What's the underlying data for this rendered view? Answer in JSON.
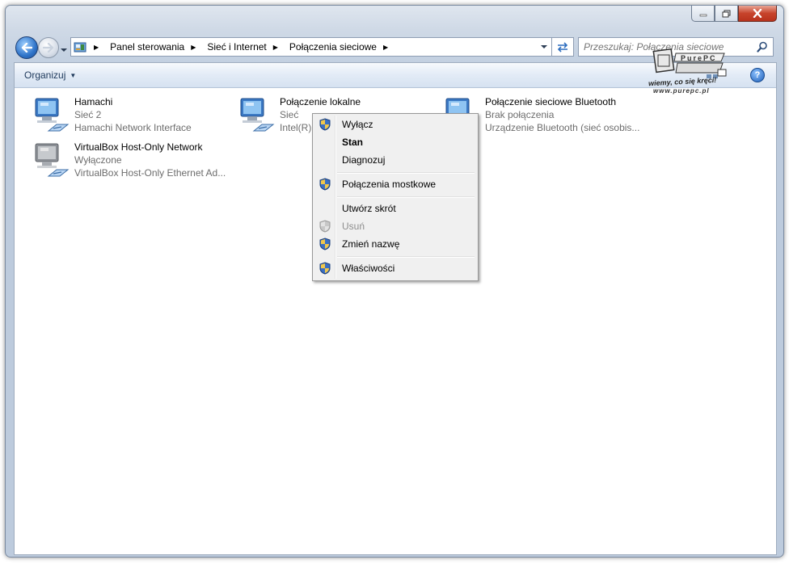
{
  "window": {
    "caption_buttons": [
      "minimize",
      "maximize",
      "close"
    ]
  },
  "address_bar": {
    "breadcrumbs": [
      "Panel sterowania",
      "Sieć i Internet",
      "Połączenia sieciowe"
    ]
  },
  "search": {
    "placeholder": "Przeszukaj: Połączenia sieciowe"
  },
  "toolbar": {
    "organize_label": "Organizuj",
    "help_label": "?"
  },
  "connections": [
    {
      "name": "Hamachi",
      "status": "Sieć  2",
      "device": "Hamachi Network Interface",
      "enabled": true
    },
    {
      "name": "Połączenie lokalne",
      "status": "Sieć",
      "device": "Intel(R) 8",
      "enabled": true
    },
    {
      "name": "Połączenie sieciowe Bluetooth",
      "status": "Brak połączenia",
      "device": "Urządzenie Bluetooth (sieć osobis...",
      "enabled": true
    },
    {
      "name": "VirtualBox Host-Only Network",
      "status": "Wyłączone",
      "device": "VirtualBox Host-Only Ethernet Ad...",
      "enabled": false
    }
  ],
  "context_menu": {
    "items": [
      {
        "label": "Wyłącz",
        "icon": "shield-icon",
        "bold": false,
        "disabled": false
      },
      {
        "label": "Stan",
        "icon": "",
        "bold": true,
        "disabled": false
      },
      {
        "label": "Diagnozuj",
        "icon": "",
        "bold": false,
        "disabled": false
      },
      {
        "label": "Połączenia mostkowe",
        "icon": "shield-icon",
        "bold": false,
        "disabled": false
      },
      {
        "label": "Utwórz skrót",
        "icon": "",
        "bold": false,
        "disabled": false
      },
      {
        "label": "Usuń",
        "icon": "shield-icon",
        "bold": false,
        "disabled": true
      },
      {
        "label": "Zmień nazwę",
        "icon": "shield-icon",
        "bold": false,
        "disabled": false
      },
      {
        "label": "Właściwości",
        "icon": "shield-icon",
        "bold": false,
        "disabled": false
      }
    ]
  },
  "watermark": {
    "text": "PurePC",
    "tagline": "wiemy, co się kręci!",
    "url": "www.purepc.pl"
  },
  "colors": {
    "accent": "#1e5fb8",
    "toolbar_text": "#1e395b",
    "secondary_text": "#6d6d6d",
    "close_button": "#c7432b"
  }
}
